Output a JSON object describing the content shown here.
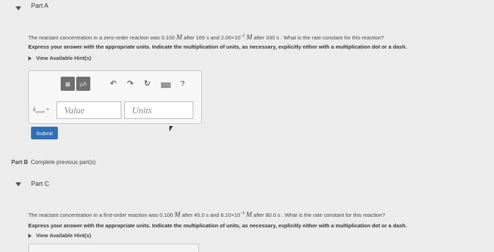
{
  "partA": {
    "title": "Part A",
    "question": {
      "p1": "The reactant concentration in a zero-order reaction was 0.100 ",
      "unit1": "M",
      "p2": " after 165 s and 2.00×10",
      "exp": "−2",
      "p3": " ",
      "unit2": "M",
      "p4": " after 330 s . What is the rate constant for this reaction?"
    },
    "instruction": "Express your answer with the appropriate units. Indicate the multiplication of units, as necessary, explicitly either with a multiplication dot or a dash.",
    "hints": "View Available Hint(s)",
    "toolbar": {
      "mu": "μA",
      "undo": "↶",
      "redo": "↷",
      "reset": "↻",
      "help": "?"
    },
    "k_label": "k",
    "k_sub": "zeroth",
    "value_placeholder": "Value",
    "units_placeholder": "Units",
    "submit": "Submit"
  },
  "partB": {
    "label": "Part B",
    "text": "Complete previous part(s)"
  },
  "partC": {
    "title": "Part C",
    "question": {
      "p1": "The reactant concentration in a first-order reaction was 0.100 ",
      "unit1": "M",
      "p2": " after 45.0 s and 8.10×10",
      "exp": "−3",
      "p3": " ",
      "unit2": "M",
      "p4": " after 80.0 s . What is the rate constant for this reaction?"
    },
    "instruction": "Express your answer with the appropriate units. Indicate the multiplication of units, as necessary, explicitly either with a multiplication dot or a dash.",
    "hints": "View Available Hint(s)"
  }
}
